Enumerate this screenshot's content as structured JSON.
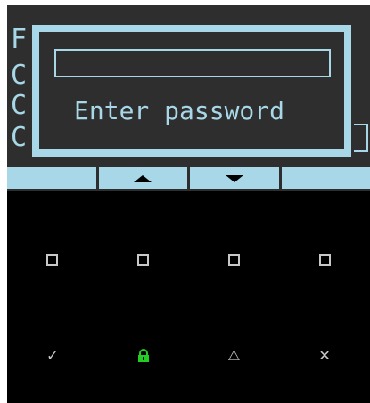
{
  "lcd": {
    "background_lines": [
      "F",
      "C",
      "C",
      "C"
    ]
  },
  "dialog": {
    "password_value": "",
    "message": "Enter password"
  },
  "softkeys": [
    {
      "name": "blank-1",
      "icon": ""
    },
    {
      "name": "up",
      "icon": "arrow-up-icon"
    },
    {
      "name": "down",
      "icon": "arrow-down-icon"
    },
    {
      "name": "blank-2",
      "icon": ""
    }
  ],
  "keypad": {
    "row1": [
      "square-icon",
      "square-icon",
      "square-icon",
      "square-icon"
    ],
    "row2": [
      {
        "icon": "check-icon",
        "glyph": "✓"
      },
      {
        "icon": "lock-icon",
        "glyph": ""
      },
      {
        "icon": "warning-icon",
        "glyph": "⚠"
      },
      {
        "icon": "close-icon",
        "glyph": "✕"
      }
    ]
  },
  "colors": {
    "lcd_accent": "#a8d8e8",
    "lcd_bg": "#2e2e2e",
    "lock_green": "#22cc22",
    "key_gray": "#c8c8c8"
  }
}
